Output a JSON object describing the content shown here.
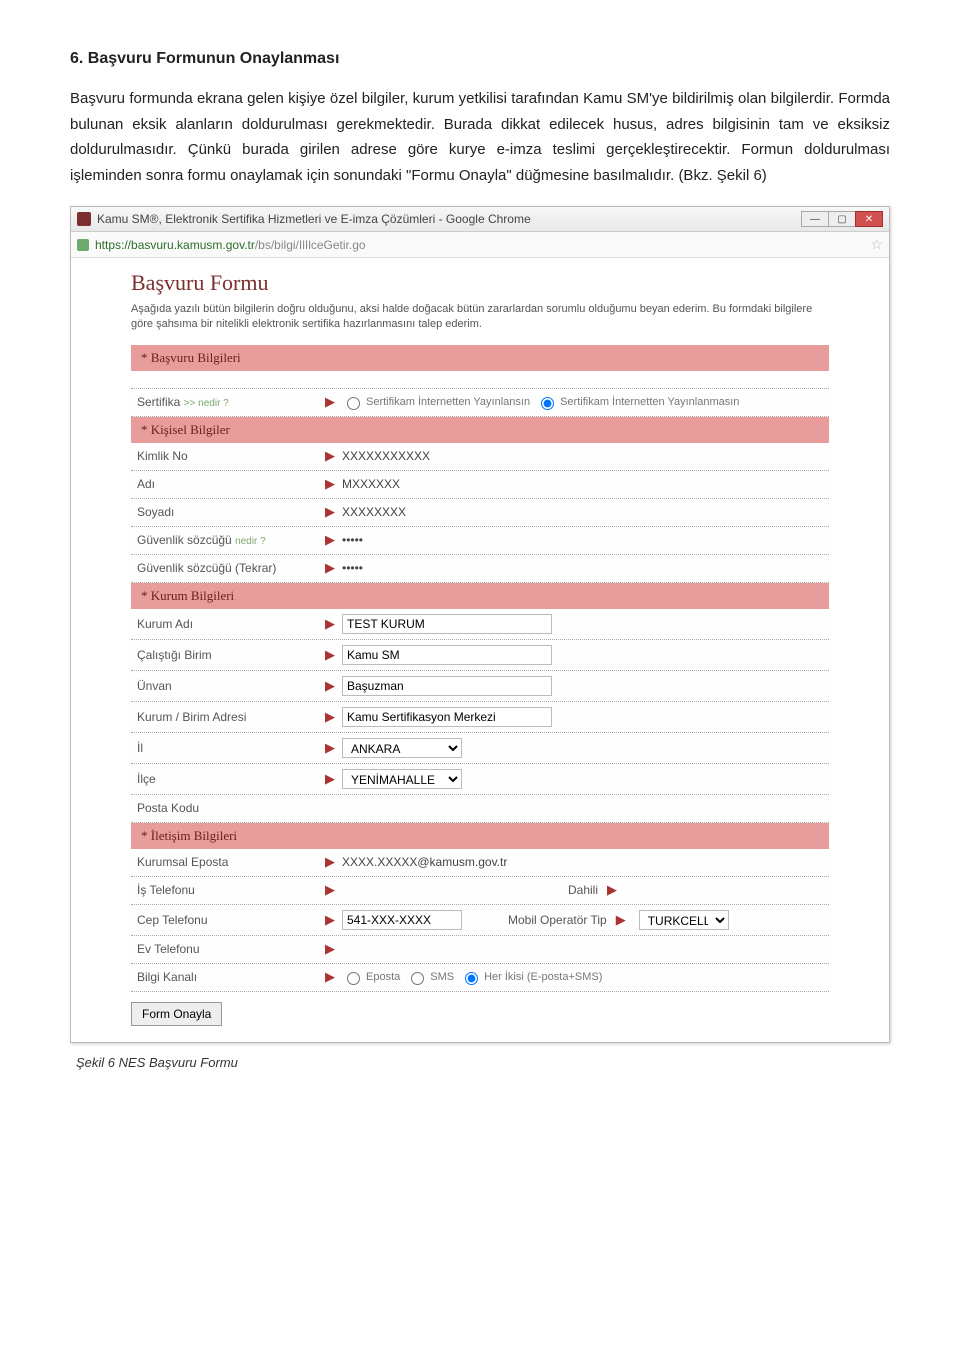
{
  "doc": {
    "heading": "6.    Başvuru Formunun Onaylanması",
    "para": "Başvuru formunda ekrana gelen kişiye özel bilgiler, kurum yetkilisi tarafından Kamu SM'ye bildirilmiş olan bilgilerdir. Formda bulunan eksik alanların doldurulması gerekmektedir. Burada dikkat edilecek husus, adres bilgisinin tam ve eksiksiz doldurulmasıdır. Çünkü burada girilen adrese göre kurye e-imza teslimi gerçekleştirecektir. Formun doldurulması işleminden sonra formu onaylamak için sonundaki \"Formu Onayla\" düğmesine basılmalıdır. (Bkz. Şekil 6)",
    "caption": "Şekil 6 NES Başvuru Formu"
  },
  "browser": {
    "title": "Kamu SM®, Elektronik Sertifika Hizmetleri ve E-imza Çözümleri - Google Chrome",
    "url_host": "https://basvuru.kamusm.gov.tr",
    "url_path": "/bs/bilgi/IlIlceGetir.go"
  },
  "form": {
    "title": "Başvuru Formu",
    "intro": "Aşağıda yazılı bütün bilgilerin doğru olduğunu, aksi halde doğacak bütün zararlardan sorumlu olduğumu beyan ederim. Bu formdaki bilgilere göre şahsıma bir nitelikli elektronik sertifika hazırlanmasını talep ederim.",
    "sections": {
      "basvuru": "*  Başvuru Bilgileri",
      "kisisel": "*  Kişisel Bilgiler",
      "kurum": "*  Kurum Bilgileri",
      "iletisim": "*  İletişim Bilgileri"
    },
    "labels": {
      "sertifika": "Sertifika",
      "sertifika_help": ">> nedir ?",
      "radio_yayin": "Sertifikam İnternetten Yayınlansın",
      "radio_yayinlanmasin": "Sertifikam İnternetten Yayınlanmasın",
      "kimlik": "Kimlik No",
      "adi": "Adı",
      "soyadi": "Soyadı",
      "guvenlik": "Güvenlik sözcüğü",
      "guvenlik_help": "nedir ?",
      "guvenlik_tekrar": "Güvenlik sözcüğü (Tekrar)",
      "kurum_adi": "Kurum Adı",
      "birim": "Çalıştığı Birim",
      "unvan": "Ünvan",
      "adres": "Kurum / Birim Adresi",
      "il": "İl",
      "ilce": "İlçe",
      "posta": "Posta Kodu",
      "eposta": "Kurumsal Eposta",
      "is_tel": "İş Telefonu",
      "dahili": "Dahili",
      "cep_tel": "Cep Telefonu",
      "operator": "Mobil Operatör Tip",
      "ev_tel": "Ev Telefonu",
      "bilgi_kanali": "Bilgi Kanalı",
      "bk_eposta": "Eposta",
      "bk_sms": "SMS",
      "bk_her": "Her İkisi (E-posta+SMS)"
    },
    "values": {
      "kimlik": "XXXXXXXXXXX",
      "adi": "MXXXXXX",
      "soyadi": "XXXXXXXX",
      "guvenlik": "•••••",
      "guvenlik_tekrar": "•••••",
      "kurum_adi": "TEST KURUM",
      "birim": "Kamu SM",
      "unvan": "Başuzman",
      "adres": "Kamu Sertifikasyon Merkezi",
      "il": "ANKARA",
      "ilce": "YENİMAHALLE",
      "posta": "",
      "eposta": "XXXX.XXXXX@kamusm.gov.tr",
      "is_tel": "",
      "cep_tel": "541-XXX-XXXX",
      "operator": "TURKCELL",
      "ev_tel": ""
    },
    "submit": "Form Onayla"
  }
}
